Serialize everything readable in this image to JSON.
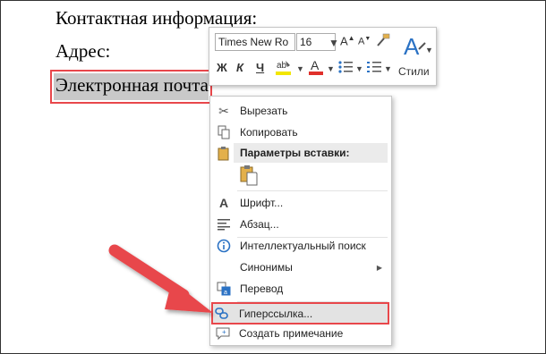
{
  "document": {
    "line1": "Контактная информация:",
    "line2": "Адрес:",
    "line3": "Электронная почта"
  },
  "mini_toolbar": {
    "font_name": "Times New Ro",
    "font_size": "16",
    "bold": "Ж",
    "italic": "К",
    "underline": "Ч",
    "styles_label": "Стили",
    "highlight_color": "#f2e600",
    "font_color": "#e0302b"
  },
  "context_menu": {
    "cut": "Вырезать",
    "copy": "Копировать",
    "paste_options": "Параметры вставки:",
    "font": "Шрифт...",
    "paragraph": "Абзац...",
    "smart_lookup": "Интеллектуальный поиск",
    "synonyms": "Синонимы",
    "translate": "Перевод",
    "hyperlink": "Гиперссылка...",
    "new_comment": "Создать примечание"
  },
  "colors": {
    "highlight_border": "#e8474b",
    "arrow": "#e8474b"
  }
}
